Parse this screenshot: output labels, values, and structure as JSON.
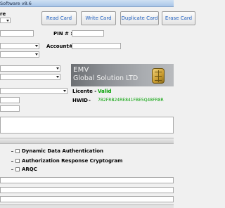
{
  "window": {
    "title": "Software v8.6"
  },
  "toolbar": {
    "reader_label": "re",
    "read_card": "Read Card",
    "write_card": "Write Card",
    "duplicate_card": "Duplicate Card",
    "erase_card": "Erase Card"
  },
  "form": {
    "pin_label": "PIN # :",
    "account_label": "Account# :"
  },
  "banner": {
    "line1": "EMV",
    "line2": "Global Solution LTD"
  },
  "license": {
    "licente_label": "Licente -",
    "licente_value": "Valid",
    "hwid_label": "HWID",
    "hwid_sep": "-",
    "hwid_value": "7B2FRB24RE841FBE5Q48FR8R"
  },
  "options": [
    {
      "label": "Dynamic Data Authentication",
      "checked": false
    },
    {
      "label": "Authorization Response Cryptogram",
      "checked": false
    },
    {
      "label": "ARQC",
      "checked": false
    }
  ],
  "colors": {
    "valid": "#00a000",
    "hwid": "#00a000",
    "button_text": "#1e5fc0"
  }
}
